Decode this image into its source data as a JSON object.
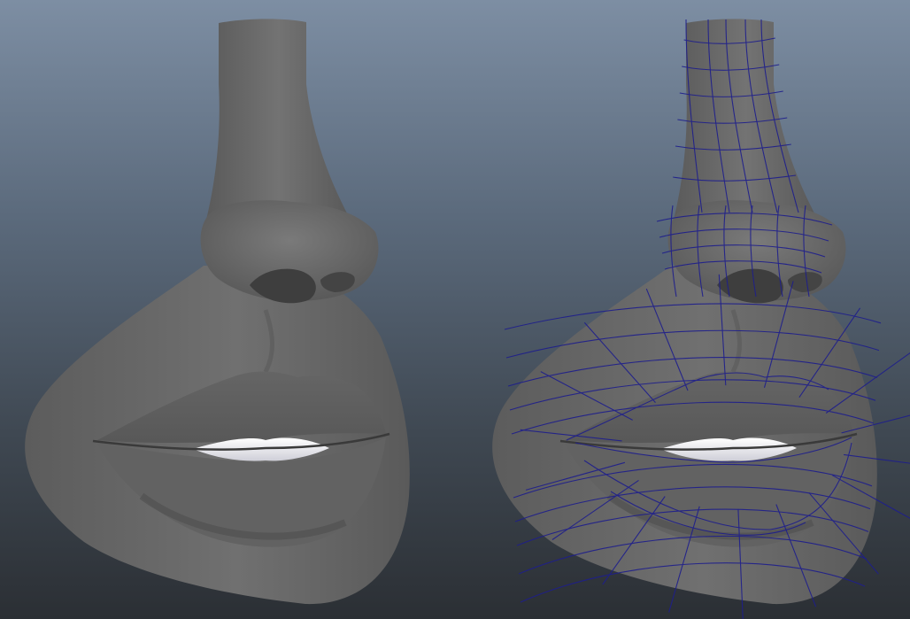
{
  "viewport": {
    "background_top": "#7d8ea3",
    "background_bottom": "#2b2f34",
    "shaded_model_color": "#6e6e6e",
    "wireframe_color": "#1e1e8c"
  }
}
